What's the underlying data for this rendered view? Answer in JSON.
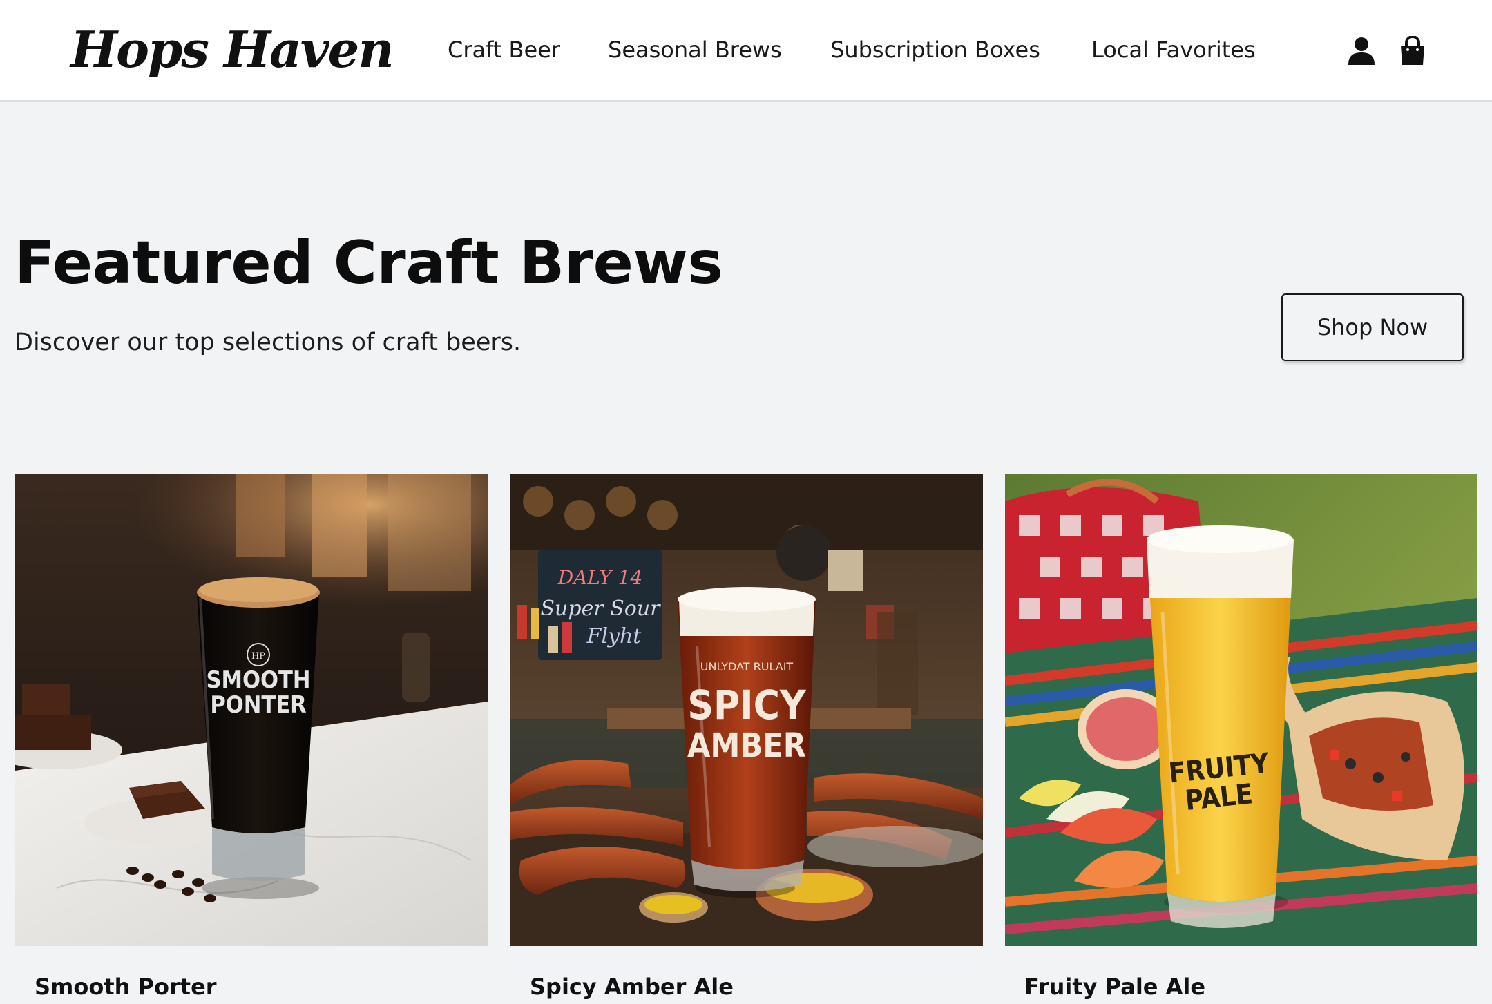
{
  "header": {
    "logo": "Hops Haven",
    "nav": [
      {
        "label": "Craft Beer"
      },
      {
        "label": "Seasonal Brews"
      },
      {
        "label": "Subscription Boxes"
      },
      {
        "label": "Local Favorites"
      }
    ],
    "icons": [
      "user-icon",
      "shopping-bag-icon"
    ]
  },
  "hero": {
    "title": "Featured Craft Brews",
    "subtitle": "Discover our top selections of craft beers.",
    "cta_label": "Shop Now"
  },
  "products": [
    {
      "name": "Smooth Porter",
      "glass_text": [
        "SMOOTH",
        "PONTER"
      ],
      "glass_crest": "HP"
    },
    {
      "name": "Spicy Amber Ale",
      "glass_text": [
        "SPICY",
        "AMBER"
      ],
      "glass_arc": "UNLYDAT RULAIT",
      "chalkboard": [
        "DALY 14",
        "Super Sour",
        "Flyht"
      ]
    },
    {
      "name": "Fruity Pale Ale",
      "glass_text": [
        "FRUITY",
        "PALE"
      ]
    }
  ],
  "colors": {
    "page_bg": "#f2f3f5",
    "header_bg": "#ffffff",
    "text": "#111111"
  }
}
